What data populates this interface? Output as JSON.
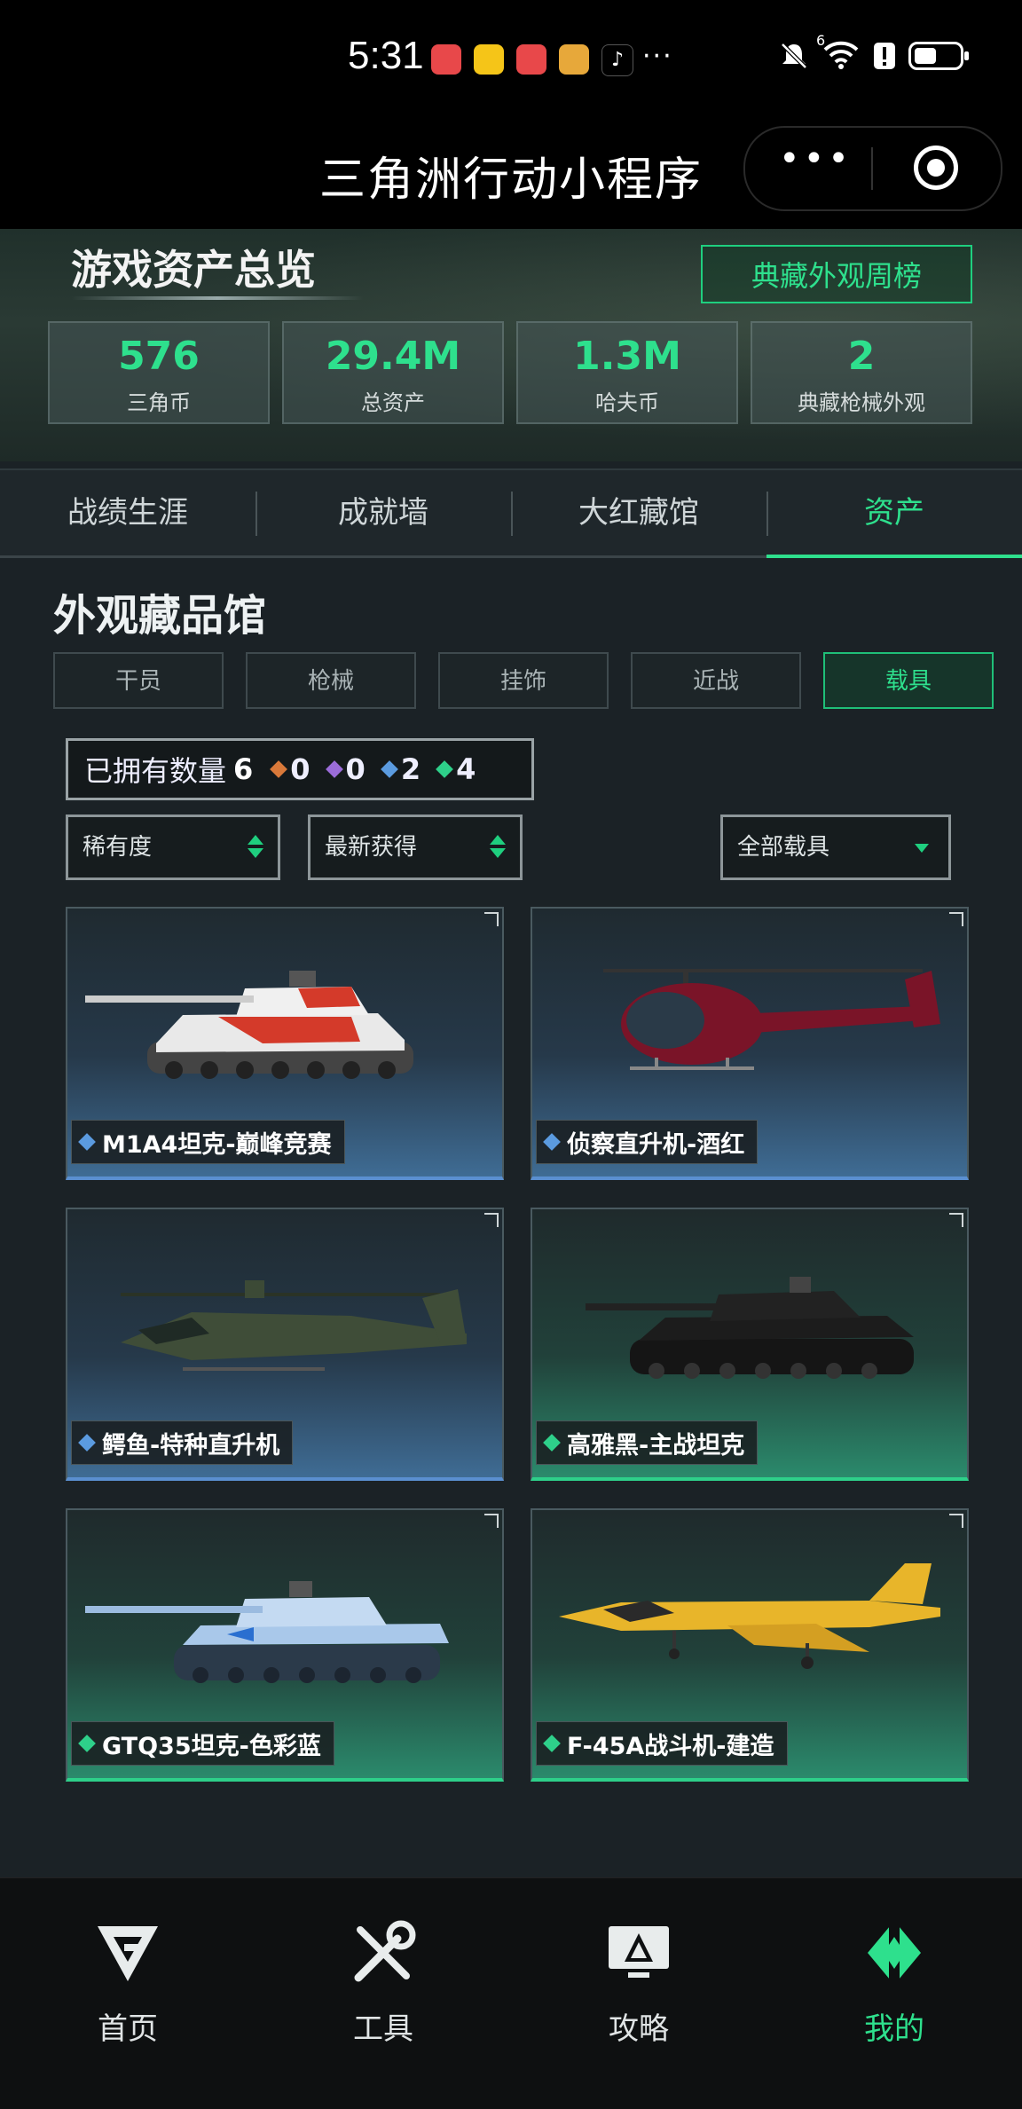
{
  "status_bar": {
    "time": "5:31",
    "network": "6",
    "icons": [
      "huawei-app-icon",
      "app-icon",
      "huawei-app-icon",
      "app-icon",
      "tiktok-icon",
      "more-dots-icon",
      "mute-icon",
      "wifi-icon",
      "alert-icon",
      "battery-icon"
    ]
  },
  "app": {
    "title": "三角洲行动小程序"
  },
  "hero": {
    "title": "游戏资产总览",
    "weekly_button": "典藏外观周榜",
    "stats": [
      {
        "value": "576",
        "label": "三角币"
      },
      {
        "value": "29.4M",
        "label": "总资产"
      },
      {
        "value": "1.3M",
        "label": "哈夫币"
      },
      {
        "value": "2",
        "label": "典藏枪械外观"
      }
    ]
  },
  "tabs": [
    {
      "label": "战绩生涯",
      "active": false
    },
    {
      "label": "成就墙",
      "active": false
    },
    {
      "label": "大红藏馆",
      "active": false
    },
    {
      "label": "资产",
      "active": true
    }
  ],
  "gallery": {
    "title": "外观藏品馆",
    "categories": [
      {
        "label": "干员",
        "active": false
      },
      {
        "label": "枪械",
        "active": false
      },
      {
        "label": "挂饰",
        "active": false
      },
      {
        "label": "近战",
        "active": false
      },
      {
        "label": "载具",
        "active": true
      }
    ],
    "owned": {
      "label": "已拥有数量",
      "count": "6",
      "rarities": [
        {
          "color": "#d9793a",
          "count": "0"
        },
        {
          "color": "#9b6cd9",
          "count": "0"
        },
        {
          "color": "#5b9be0",
          "count": "2"
        },
        {
          "color": "#2ed08a",
          "count": "4"
        }
      ]
    },
    "filters": {
      "rarity": "稀有度",
      "sort": "最新获得",
      "type": "全部载具"
    },
    "items": [
      {
        "name": "M1A4坦克-巅峰竞赛",
        "rarity": "blue",
        "vehicle": "tank"
      },
      {
        "name": "侦察直升机-酒红",
        "rarity": "blue",
        "vehicle": "scout-helicopter"
      },
      {
        "name": "鳄鱼-特种直升机",
        "rarity": "blue",
        "vehicle": "attack-helicopter"
      },
      {
        "name": "高雅黑-主战坦克",
        "rarity": "green",
        "vehicle": "tank"
      },
      {
        "name": "GTQ35坦克-色彩蓝",
        "rarity": "green",
        "vehicle": "tank"
      },
      {
        "name": "F-45A战斗机-建造",
        "rarity": "green",
        "vehicle": "fighter-jet"
      }
    ]
  },
  "bottom_nav": [
    {
      "label": "首页",
      "icon": "home-logo-icon",
      "active": false
    },
    {
      "label": "工具",
      "icon": "tools-icon",
      "active": false
    },
    {
      "label": "攻略",
      "icon": "guide-icon",
      "active": false
    },
    {
      "label": "我的",
      "icon": "profile-logo-icon",
      "active": true
    }
  ],
  "colors": {
    "accent": "#2ee08d",
    "blue_rarity": "#5b9be0",
    "green_rarity": "#2ed08a"
  }
}
